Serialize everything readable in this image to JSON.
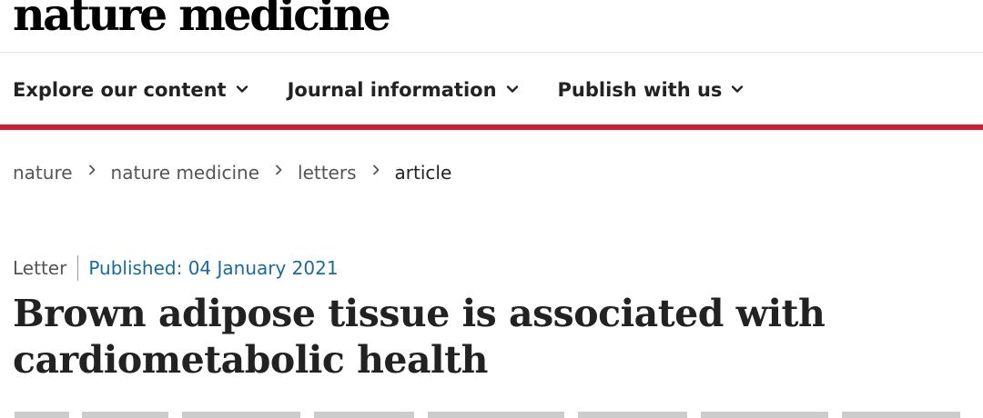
{
  "brand": {
    "logo_text": "nature medicine",
    "accent_color": "#d31e32"
  },
  "nav": {
    "items": [
      {
        "label": "Explore our content",
        "icon": "chevron-down-icon"
      },
      {
        "label": "Journal information",
        "icon": "chevron-down-icon"
      },
      {
        "label": "Publish with us",
        "icon": "chevron-down-icon"
      }
    ]
  },
  "breadcrumb": {
    "items": [
      {
        "label": "nature"
      },
      {
        "label": "nature medicine"
      },
      {
        "label": "letters"
      },
      {
        "label": "article"
      }
    ],
    "separator_icon": "chevron-right-icon"
  },
  "article": {
    "type": "Letter",
    "published": "Published: 04 January 2021",
    "title": "Brown adipose tissue is associated with cardiometabolic health",
    "published_color": "#1a6a9a"
  }
}
